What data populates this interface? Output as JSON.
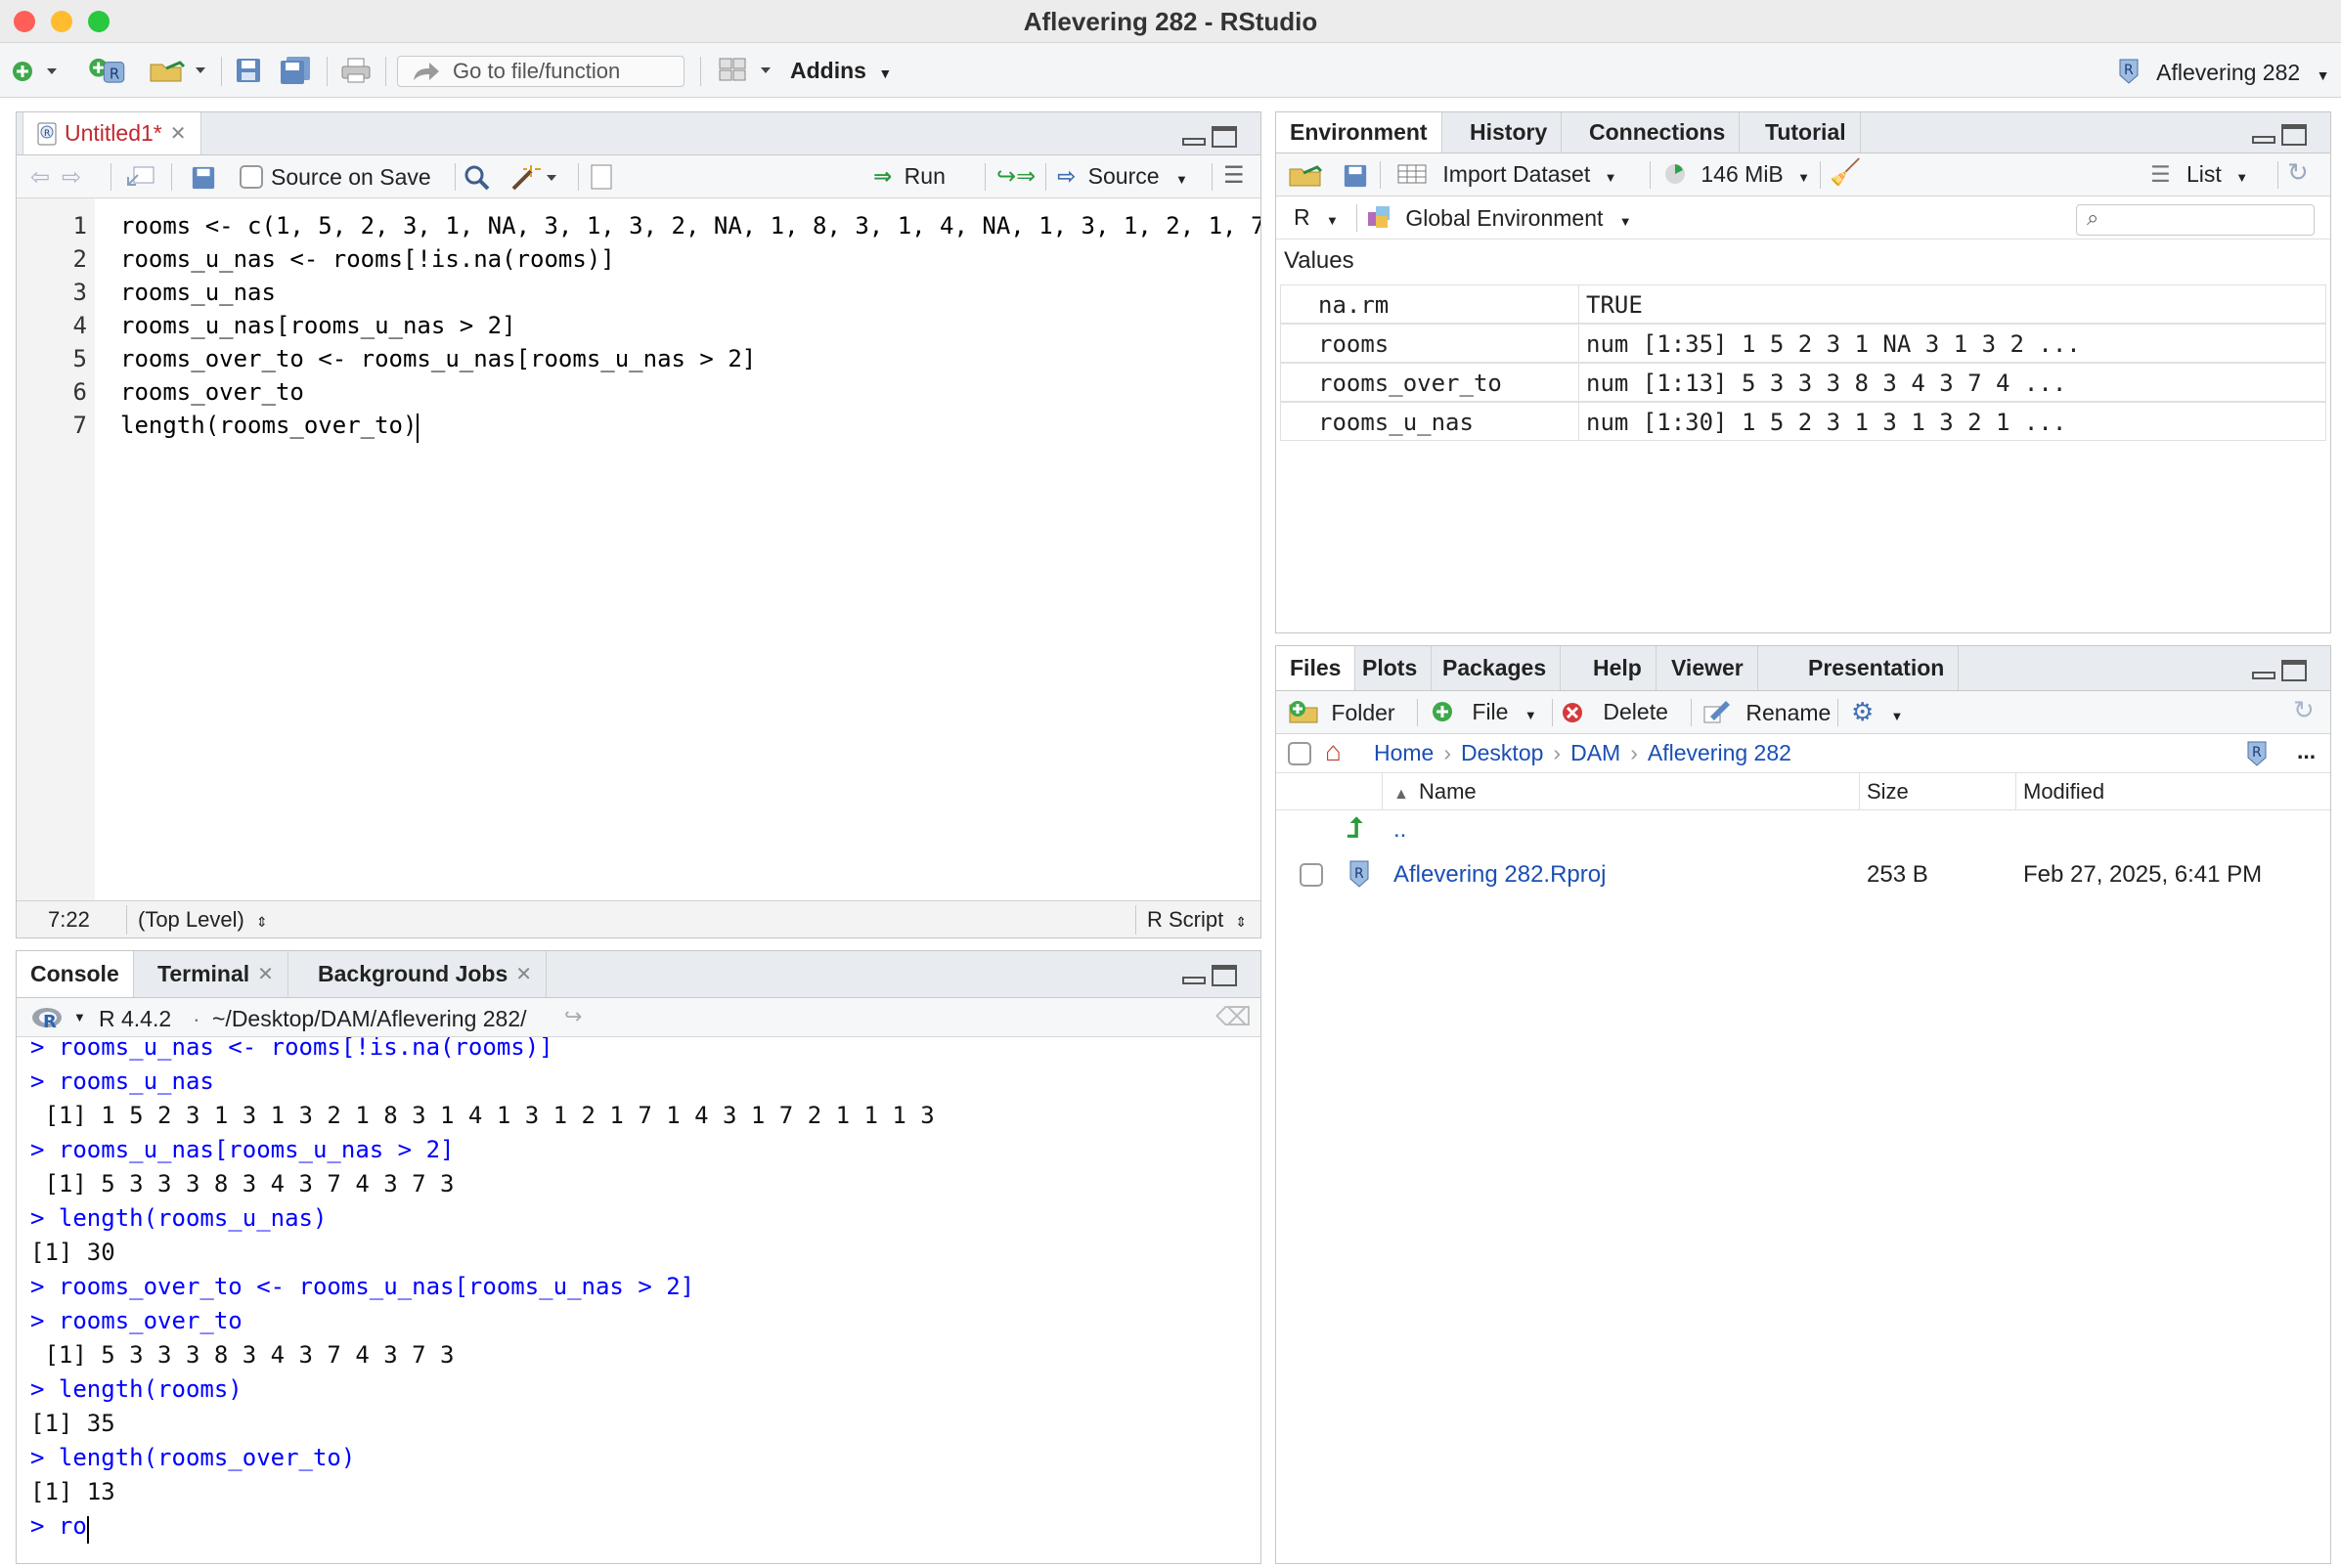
{
  "window": {
    "title": "Aflevering 282 - RStudio"
  },
  "main_toolbar": {
    "goto_placeholder": "Go to file/function",
    "addins_label": "Addins",
    "project_label": "Aflevering 282"
  },
  "editor": {
    "tab_label": "Untitled1*",
    "source_on_save": "Source on Save",
    "run_label": "Run",
    "source_label": "Source",
    "lines": [
      {
        "num": "1",
        "text": "rooms <- c(1, 5, 2, 3, 1, NA, 3, 1, 3, 2, NA, 1, 8, 3, 1, 4, NA, 1, 3, 1, 2, 1, 7,"
      },
      {
        "num": "2",
        "text": "rooms_u_nas <- rooms[!is.na(rooms)]"
      },
      {
        "num": "3",
        "text": "rooms_u_nas"
      },
      {
        "num": "4",
        "text": "rooms_u_nas[rooms_u_nas > 2]"
      },
      {
        "num": "5",
        "text": "rooms_over_to <- rooms_u_nas[rooms_u_nas > 2]"
      },
      {
        "num": "6",
        "text": "rooms_over_to"
      },
      {
        "num": "7",
        "text": "length(rooms_over_to)"
      }
    ],
    "cursor_pos": "7:22",
    "scope": "(Top Level)",
    "file_type": "R Script"
  },
  "console_pane": {
    "tabs": [
      "Console",
      "Terminal",
      "Background Jobs"
    ],
    "r_version": "R 4.4.2",
    "path": "~/Desktop/DAM/Aflevering 282/",
    "lines": [
      {
        "kind": "cmd",
        "text": "> rooms_u_nas <- rooms[!is.na(rooms)]"
      },
      {
        "kind": "cmd",
        "text": "> rooms_u_nas"
      },
      {
        "kind": "out",
        "text": " [1] 1 5 2 3 1 3 1 3 2 1 8 3 1 4 1 3 1 2 1 7 1 4 3 1 7 2 1 1 1 3"
      },
      {
        "kind": "cmd",
        "text": "> rooms_u_nas[rooms_u_nas > 2]"
      },
      {
        "kind": "out",
        "text": " [1] 5 3 3 3 8 3 4 3 7 4 3 7 3"
      },
      {
        "kind": "cmd",
        "text": "> length(rooms_u_nas)"
      },
      {
        "kind": "out",
        "text": "[1] 30"
      },
      {
        "kind": "cmd",
        "text": "> rooms_over_to <- rooms_u_nas[rooms_u_nas > 2]"
      },
      {
        "kind": "cmd",
        "text": "> rooms_over_to"
      },
      {
        "kind": "out",
        "text": " [1] 5 3 3 3 8 3 4 3 7 4 3 7 3"
      },
      {
        "kind": "cmd",
        "text": "> length(rooms)"
      },
      {
        "kind": "out",
        "text": "[1] 35"
      },
      {
        "kind": "cmd",
        "text": "> length(rooms_over_to)"
      },
      {
        "kind": "out",
        "text": "[1] 13"
      },
      {
        "kind": "cmd",
        "text": "> ro"
      }
    ]
  },
  "env_pane": {
    "tabs": [
      "Environment",
      "History",
      "Connections",
      "Tutorial"
    ],
    "import_dataset": "Import Dataset",
    "memory": "146 MiB",
    "list_label": "List",
    "lang": "R",
    "scope": "Global Environment",
    "section": "Values",
    "rows": [
      {
        "name": "na.rm",
        "value": "TRUE"
      },
      {
        "name": "rooms",
        "value": "num [1:35] 1 5 2 3 1 NA 3 1 3 2 ..."
      },
      {
        "name": "rooms_over_to",
        "value": "num [1:13] 5 3 3 3 8 3 4 3 7 4 ..."
      },
      {
        "name": "rooms_u_nas",
        "value": "num [1:30] 1 5 2 3 1 3 1 3 2 1 ..."
      }
    ]
  },
  "files_pane": {
    "tabs": [
      "Files",
      "Plots",
      "Packages",
      "Help",
      "Viewer",
      "Presentation"
    ],
    "folder": "Folder",
    "file": "File",
    "delete": "Delete",
    "rename": "Rename",
    "breadcrumb": [
      "Home",
      "Desktop",
      "DAM",
      "Aflevering 282"
    ],
    "more": "...",
    "columns": {
      "name": "Name",
      "size": "Size",
      "modified": "Modified"
    },
    "parent": "..",
    "files": [
      {
        "name": "Aflevering 282.Rproj",
        "size": "253 B",
        "modified": "Feb 27, 2025, 6:41 PM"
      }
    ]
  }
}
